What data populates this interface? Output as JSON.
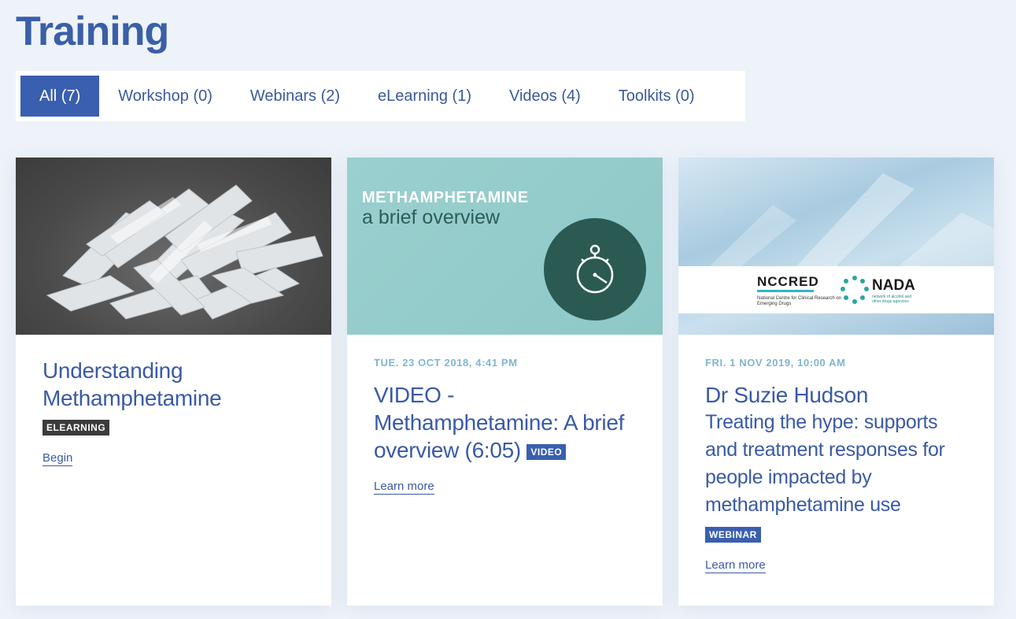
{
  "page": {
    "title": "Training"
  },
  "filters": [
    {
      "label": "All (7)",
      "active": true
    },
    {
      "label": "Workshop (0)",
      "active": false
    },
    {
      "label": "Webinars (2)",
      "active": false
    },
    {
      "label": "eLearning (1)",
      "active": false
    },
    {
      "label": "Videos (4)",
      "active": false
    },
    {
      "label": "Toolkits (0)",
      "active": false
    }
  ],
  "cards": [
    {
      "date": "",
      "title": "Understanding Methamphetamine",
      "badge": "ELEARNING",
      "link": "Begin"
    },
    {
      "date": "TUE. 23 OCT 2018, 4:41 PM",
      "title": "VIDEO - Methamphetamine: A brief overview (6:05)",
      "badge": "VIDEO",
      "link": "Learn more",
      "image_text": {
        "line1": "METHAMPHETAMINE",
        "line2": "a brief overview"
      }
    },
    {
      "date": "FRI. 1 NOV 2019, 10:00 AM",
      "title": "Dr Suzie Hudson",
      "subtitle": "Treating the hype: supports and treatment responses for people impacted by methamphetamine use",
      "badge": "WEBINAR",
      "link": "Learn more",
      "image_text": {
        "nccred": "NCCRED",
        "nccred_sub": "National Centre for Clinical Research on Emerging Drugs",
        "nada": "NADA",
        "nada_sub": "network of alcohol and other drugs agencies"
      }
    }
  ],
  "colors": {
    "accent": "#3a5fb0",
    "background": "#eef3f9",
    "date": "#7fb6cf"
  }
}
